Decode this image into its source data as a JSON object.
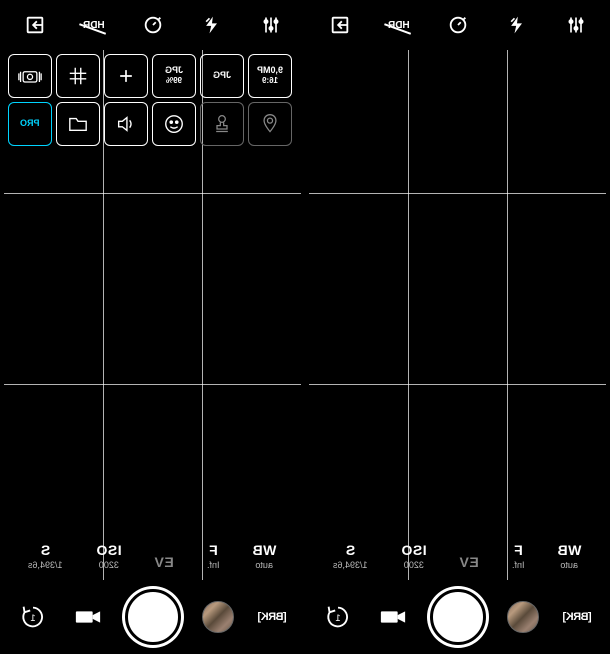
{
  "topbar": {
    "import": "import",
    "hdr": "HDR",
    "timer": "timer",
    "flash": "flash",
    "settings": "settings"
  },
  "options": {
    "camera_bracket": "camera",
    "grid": "#",
    "crosshair": "+",
    "jpg_quality_label1": "JPG",
    "jpg_quality_label2": "99%",
    "jpg_label": "JPG",
    "resolution_label1": "9,0MP",
    "resolution_label2": "16:9",
    "pro_label": "PRO",
    "folder": "folder",
    "sound": "sound",
    "emoji": "☺",
    "stamp": "stamp",
    "location": "location"
  },
  "params": {
    "shutter_label": "S",
    "shutter_value": "1/394,6s",
    "iso_label": "ISO",
    "iso_value": "3200",
    "ev_label": "EV",
    "aperture_label": "F",
    "aperture_value": "Inf.",
    "wb_label": "WB",
    "wb_value": "auto"
  },
  "bottom": {
    "rotate": "rotate",
    "video": "video",
    "shutter": "shutter",
    "gallery": "gallery",
    "brk_label": "[BRK]"
  }
}
